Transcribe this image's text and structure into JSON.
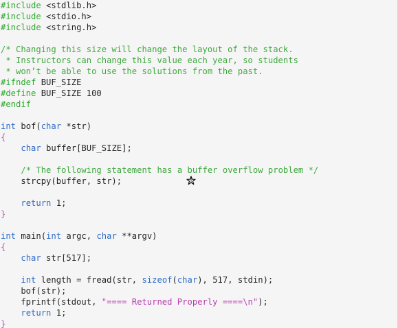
{
  "colors": {
    "background": "#f5f5f5",
    "preprocessor": "#2eab2e",
    "type_keyword": "#2f6bc8",
    "comment": "#3fa83f",
    "string": "#b93cb0",
    "plain": "#262626",
    "brace": "#b05fa8"
  },
  "cursor_icon": "star-cursor-icon",
  "code_lines": [
    [
      {
        "t": "#include ",
        "c": "pre"
      },
      {
        "t": "<stdlib.h>",
        "c": "plain"
      }
    ],
    [
      {
        "t": "#include ",
        "c": "pre"
      },
      {
        "t": "<stdio.h>",
        "c": "plain"
      }
    ],
    [
      {
        "t": "#include ",
        "c": "pre"
      },
      {
        "t": "<string.h>",
        "c": "plain"
      }
    ],
    [],
    [
      {
        "t": "/* Changing this size will change the layout of the stack.",
        "c": "comment"
      }
    ],
    [
      {
        "t": " * Instructors can change this value each year, so students",
        "c": "comment"
      }
    ],
    [
      {
        "t": " * won’t be able to use the solutions from the past.",
        "c": "comment"
      }
    ],
    [
      {
        "t": "#ifndef ",
        "c": "pre"
      },
      {
        "t": "BUF_SIZE",
        "c": "plain"
      }
    ],
    [
      {
        "t": "#define ",
        "c": "pre"
      },
      {
        "t": "BUF_SIZE 100",
        "c": "plain"
      }
    ],
    [
      {
        "t": "#endif",
        "c": "pre"
      }
    ],
    [],
    [
      {
        "t": "int",
        "c": "type"
      },
      {
        "t": " bof(",
        "c": "plain"
      },
      {
        "t": "char",
        "c": "type"
      },
      {
        "t": " *str)",
        "c": "plain"
      }
    ],
    [
      {
        "t": "{",
        "c": "brace"
      }
    ],
    [
      {
        "t": "    ",
        "c": "plain"
      },
      {
        "t": "char",
        "c": "type"
      },
      {
        "t": " buffer[BUF_SIZE];",
        "c": "plain"
      }
    ],
    [],
    [
      {
        "t": "    ",
        "c": "plain"
      },
      {
        "t": "/* The following statement has a buffer overflow problem */",
        "c": "comment"
      }
    ],
    [
      {
        "t": "    strcpy(buffer, str);",
        "c": "plain"
      }
    ],
    [],
    [
      {
        "t": "    ",
        "c": "plain"
      },
      {
        "t": "return",
        "c": "type"
      },
      {
        "t": " 1;",
        "c": "plain"
      }
    ],
    [
      {
        "t": "}",
        "c": "brace"
      }
    ],
    [],
    [
      {
        "t": "int",
        "c": "type"
      },
      {
        "t": " main(",
        "c": "plain"
      },
      {
        "t": "int",
        "c": "type"
      },
      {
        "t": " argc, ",
        "c": "plain"
      },
      {
        "t": "char",
        "c": "type"
      },
      {
        "t": " **argv)",
        "c": "plain"
      }
    ],
    [
      {
        "t": "{",
        "c": "brace"
      }
    ],
    [
      {
        "t": "    ",
        "c": "plain"
      },
      {
        "t": "char",
        "c": "type"
      },
      {
        "t": " str[517];",
        "c": "plain"
      }
    ],
    [],
    [
      {
        "t": "    ",
        "c": "plain"
      },
      {
        "t": "int",
        "c": "type"
      },
      {
        "t": " length = fread(str, ",
        "c": "plain"
      },
      {
        "t": "sizeof",
        "c": "type"
      },
      {
        "t": "(",
        "c": "plain"
      },
      {
        "t": "char",
        "c": "type"
      },
      {
        "t": "), 517, stdin);",
        "c": "plain"
      }
    ],
    [
      {
        "t": "    bof(str);",
        "c": "plain"
      }
    ],
    [
      {
        "t": "    fprintf(stdout, ",
        "c": "plain"
      },
      {
        "t": "\"==== Returned Properly ====\\n\"",
        "c": "string"
      },
      {
        "t": ");",
        "c": "plain"
      }
    ],
    [
      {
        "t": "    ",
        "c": "plain"
      },
      {
        "t": "return",
        "c": "type"
      },
      {
        "t": " 1;",
        "c": "plain"
      }
    ],
    [
      {
        "t": "}",
        "c": "brace"
      }
    ]
  ]
}
